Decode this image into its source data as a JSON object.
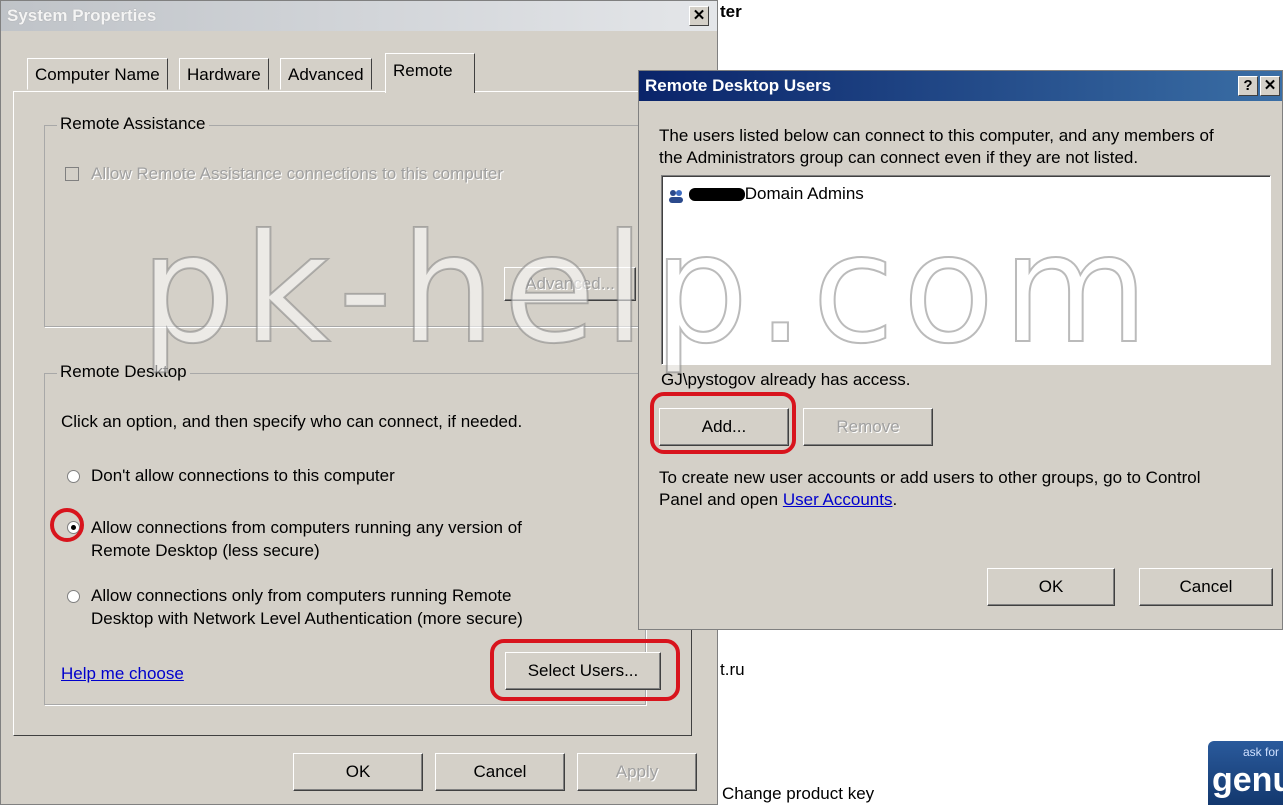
{
  "background_window": {
    "partial_title": "ter",
    "domain_fragment": "t.ru",
    "change_product_key": "Change product key",
    "genuine_badge": {
      "top": "ask for",
      "main": "genu"
    }
  },
  "system_properties": {
    "title": "System Properties",
    "close_glyph": "✕",
    "tabs": [
      {
        "label": "Computer Name",
        "active": false
      },
      {
        "label": "Hardware",
        "active": false
      },
      {
        "label": "Advanced",
        "active": false
      },
      {
        "label": "Remote",
        "active": true
      }
    ],
    "remote_assistance": {
      "group_label": "Remote Assistance",
      "checkbox_label": "Allow Remote Assistance connections to this computer",
      "advanced_button": "Advanced..."
    },
    "remote_desktop": {
      "group_label": "Remote Desktop",
      "instruction": "Click an option, and then specify who can connect, if needed.",
      "options": [
        {
          "label": "Don't allow connections to this computer",
          "checked": false
        },
        {
          "label_line1": "Allow connections from computers running any version of",
          "label_line2": "Remote Desktop (less secure)",
          "checked": true
        },
        {
          "label_line1": "Allow connections only from computers running Remote",
          "label_line2": "Desktop with Network Level Authentication (more secure)",
          "checked": false
        }
      ],
      "help_link": "Help me choose",
      "select_users_button": "Select Users..."
    },
    "footer": {
      "ok": "OK",
      "cancel": "Cancel",
      "apply": "Apply"
    }
  },
  "remote_desktop_users": {
    "title": "Remote Desktop Users",
    "help_glyph": "?",
    "close_glyph": "✕",
    "description_line1": "The users listed below can connect to this computer, and any members of",
    "description_line2": "the Administrators group can connect even if they are not listed.",
    "users": [
      {
        "name": "Domain Admins"
      }
    ],
    "access_note": "GJ\\pystogov already has access.",
    "add_button": "Add...",
    "remove_button": "Remove",
    "footer_text_line1": "To create new user accounts or add users to other groups, go to Control",
    "footer_text_prefix": "Panel and open ",
    "user_accounts_link": "User Accounts",
    "footer_text_suffix": ".",
    "ok": "OK",
    "cancel": "Cancel"
  },
  "watermark": "pk-help.com",
  "colors": {
    "annotation_red": "#d8141d",
    "dialog_face": "#d4d0c8",
    "title_blue": "#0a246a"
  }
}
